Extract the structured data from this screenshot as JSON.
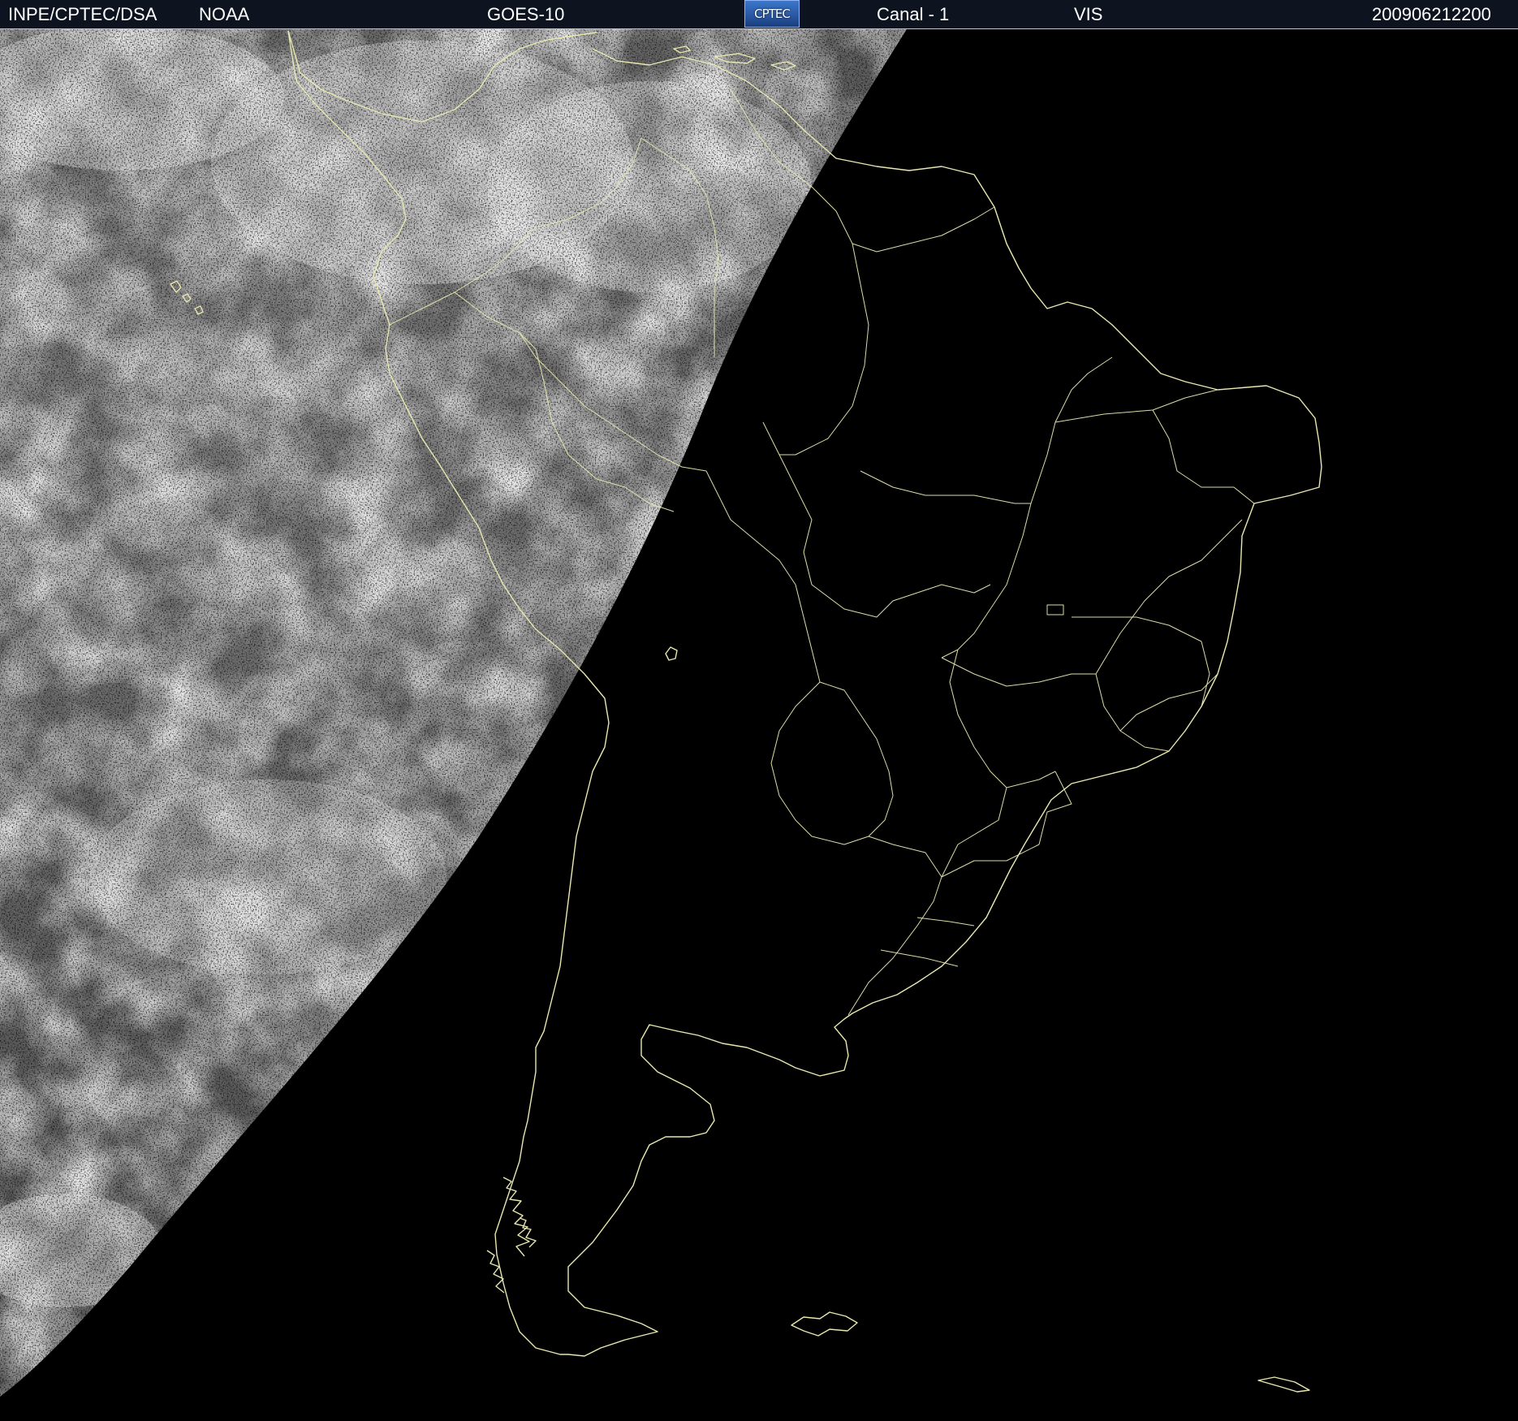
{
  "header": {
    "agency": "INPE/CPTEC/DSA",
    "noaa": "NOAA",
    "satellite": "GOES-10",
    "logo_text": "CPTEC",
    "channel": "Canal - 1",
    "band": "VIS",
    "timestamp": "200906212200"
  },
  "colors": {
    "header_bg": "#0d1420",
    "coastline": "#e8e8b0",
    "night_side": "#000000",
    "logo_blue": "#2a59a6"
  },
  "icons": {
    "logo": "cptec-logo"
  }
}
